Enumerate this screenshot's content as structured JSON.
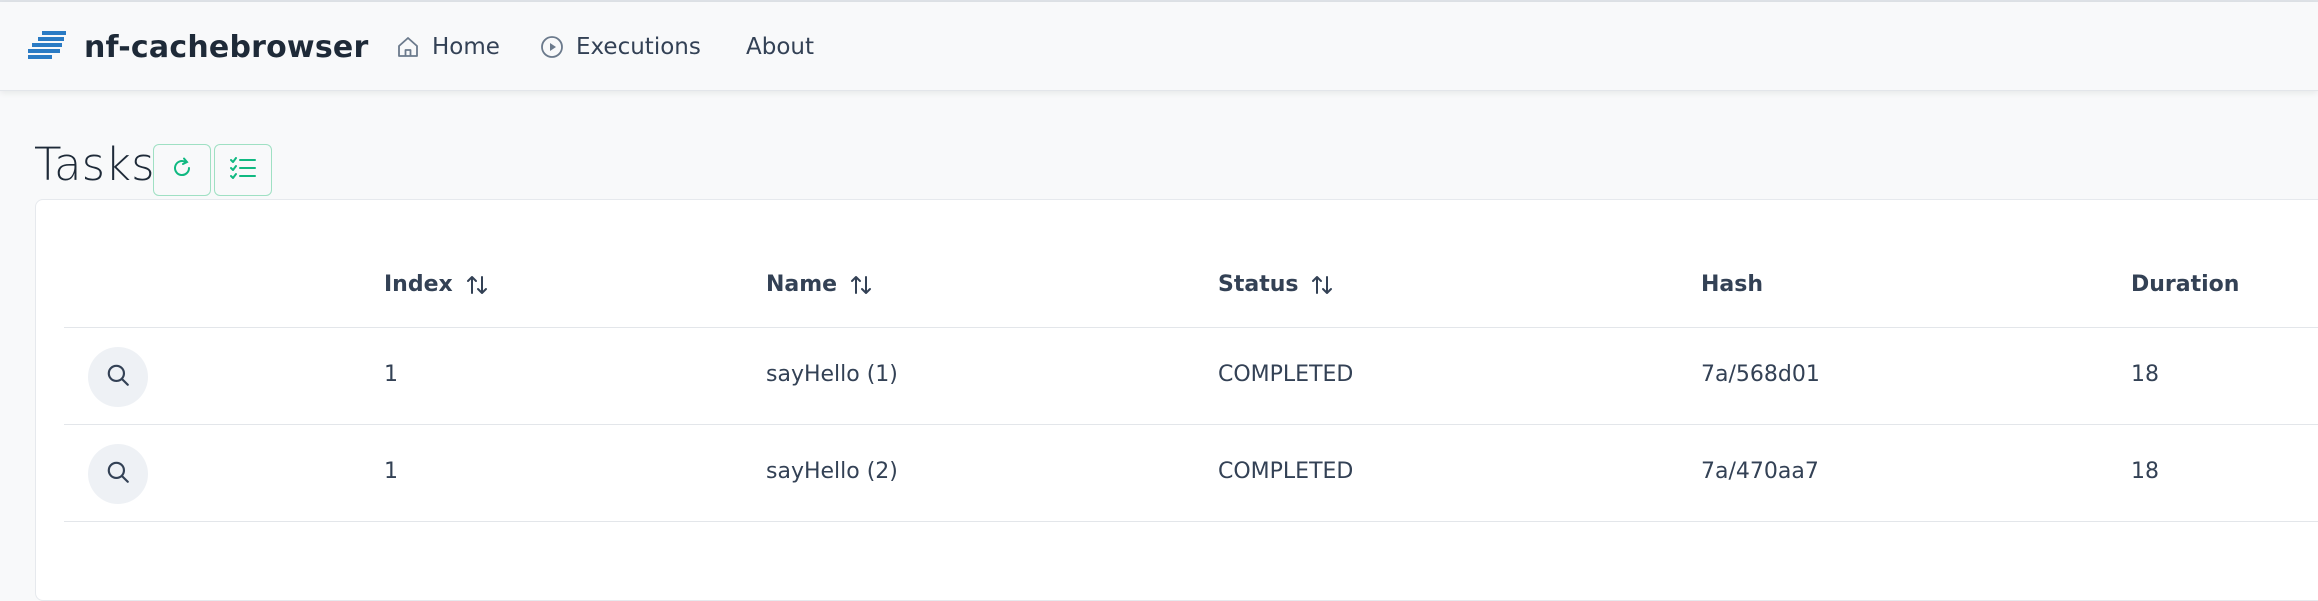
{
  "app": {
    "title": "nf-cachebrowser"
  },
  "nav": {
    "home": "Home",
    "executions": "Executions",
    "about": "About"
  },
  "page": {
    "title": "Tasks"
  },
  "toolbar": {
    "refresh_icon": "refresh-icon",
    "list_icon": "list-check-icon",
    "accent": "#10b981"
  },
  "table": {
    "columns": {
      "index": "Index",
      "name": "Name",
      "status": "Status",
      "hash": "Hash",
      "duration": "Duration"
    },
    "rows": [
      {
        "index": "1",
        "name": "sayHello (1)",
        "status": "COMPLETED",
        "hash": "7a/568d01",
        "duration": "18"
      },
      {
        "index": "1",
        "name": "sayHello (2)",
        "status": "COMPLETED",
        "hash": "7a/470aa7",
        "duration": "18"
      }
    ]
  }
}
